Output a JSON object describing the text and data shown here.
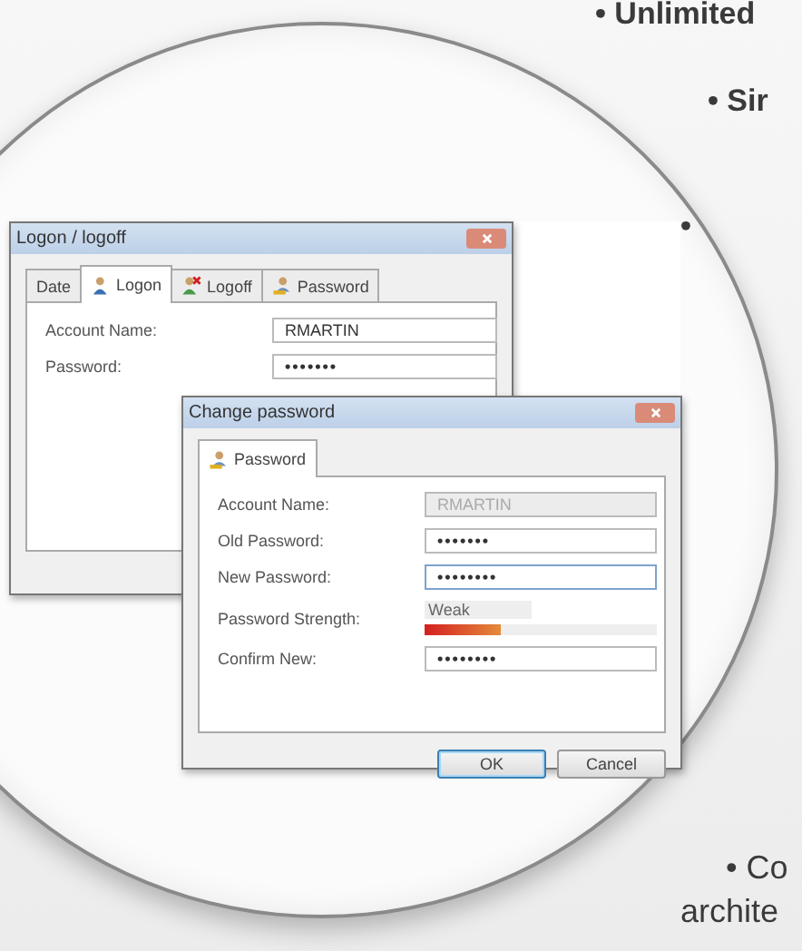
{
  "bullets": [
    {
      "text": "• Unlimited",
      "bold": true
    },
    {
      "text": "• Sir",
      "bold": true
    },
    {
      "text": "•",
      "bold": true
    },
    {
      "text": "• Co",
      "bold": false
    },
    {
      "text": "archite",
      "bold": false
    }
  ],
  "logon_window": {
    "title": "Logon / logoff",
    "tabs": [
      {
        "label": "Date",
        "selected": false
      },
      {
        "label": "Logon",
        "selected": true
      },
      {
        "label": "Logoff",
        "selected": false
      },
      {
        "label": "Password",
        "selected": false
      }
    ],
    "fields": [
      {
        "label": "Account Name:",
        "value": "RMARTIN",
        "kind": "text",
        "disabled": false,
        "focused": false
      },
      {
        "label": "Password:",
        "value": "•••••••",
        "kind": "password",
        "disabled": false,
        "focused": false
      }
    ]
  },
  "change_password_window": {
    "title": "Change password",
    "tabs": [
      {
        "label": "Password",
        "selected": true
      }
    ],
    "fields": [
      {
        "label": "Account Name:",
        "value": "RMARTIN",
        "kind": "text",
        "disabled": true,
        "focused": false
      },
      {
        "label": "Old Password:",
        "value": "•••••••",
        "kind": "password",
        "disabled": false,
        "focused": false
      },
      {
        "label": "New Password:",
        "value": "••••••••",
        "kind": "password",
        "disabled": false,
        "focused": true
      },
      {
        "label": "Password Strength:",
        "reading": "Weak",
        "level": 0.33,
        "kind": "meter"
      },
      {
        "label": "Confirm New:",
        "value": "••••••••",
        "kind": "password",
        "disabled": false,
        "focused": false
      }
    ],
    "buttons": [
      {
        "label": "OK",
        "default": true
      },
      {
        "label": "Cancel",
        "default": false
      }
    ]
  }
}
